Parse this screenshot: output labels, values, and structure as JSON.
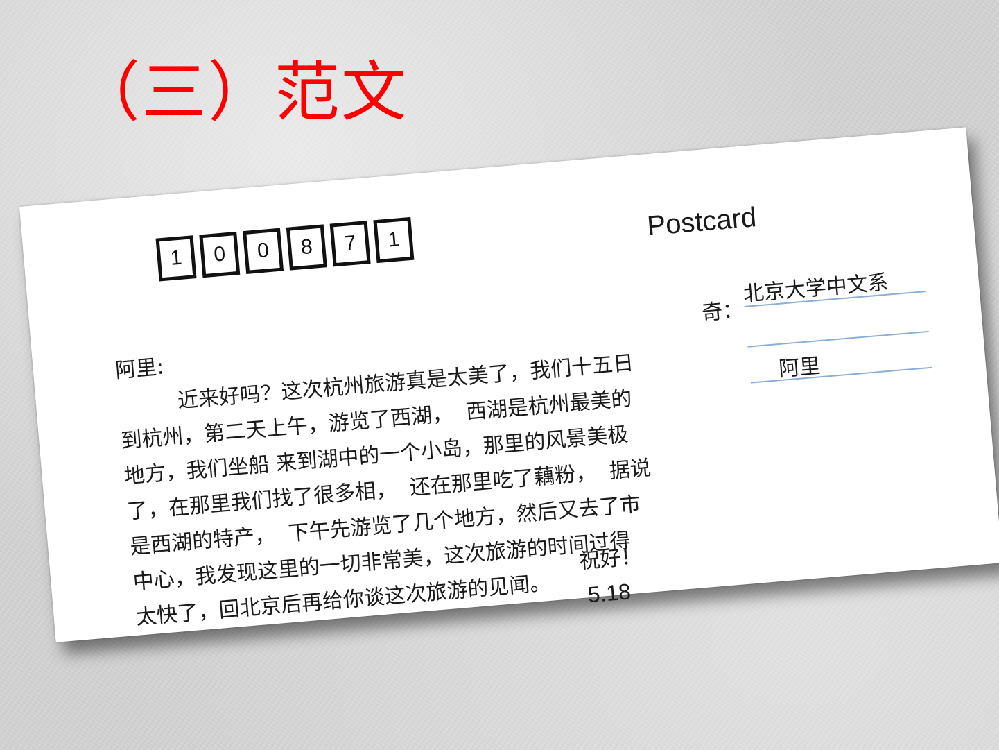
{
  "slide": {
    "title": "（三）范文"
  },
  "postcard": {
    "zip_code": [
      "1",
      "0",
      "0",
      "8",
      "7",
      "1"
    ],
    "label": "Postcard",
    "salutation": "阿里:",
    "body_lines": [
      "近来好吗？这次杭州旅游真是太美了，我们十五日",
      "到杭州，第二天上午，游览了西湖，  西湖是杭州最美的",
      "地方，我们坐船 来到湖中的一个小岛，那里的风景美极",
      "了，在那里我们找了很多相，  还在那里吃了藕粉，  据说",
      "是西湖的特产，  下午先游览了几个地方，然后又去了市",
      "中心，我发现这里的一切非常美，这次旅游的时间过得",
      "太快了，回北京后再给你谈这次旅游的见闻。"
    ],
    "closing": "祝好！",
    "date": "5.18",
    "sender_label": "奇：",
    "address_lines": [
      "北京大学中文系",
      "",
      "阿里"
    ]
  }
}
